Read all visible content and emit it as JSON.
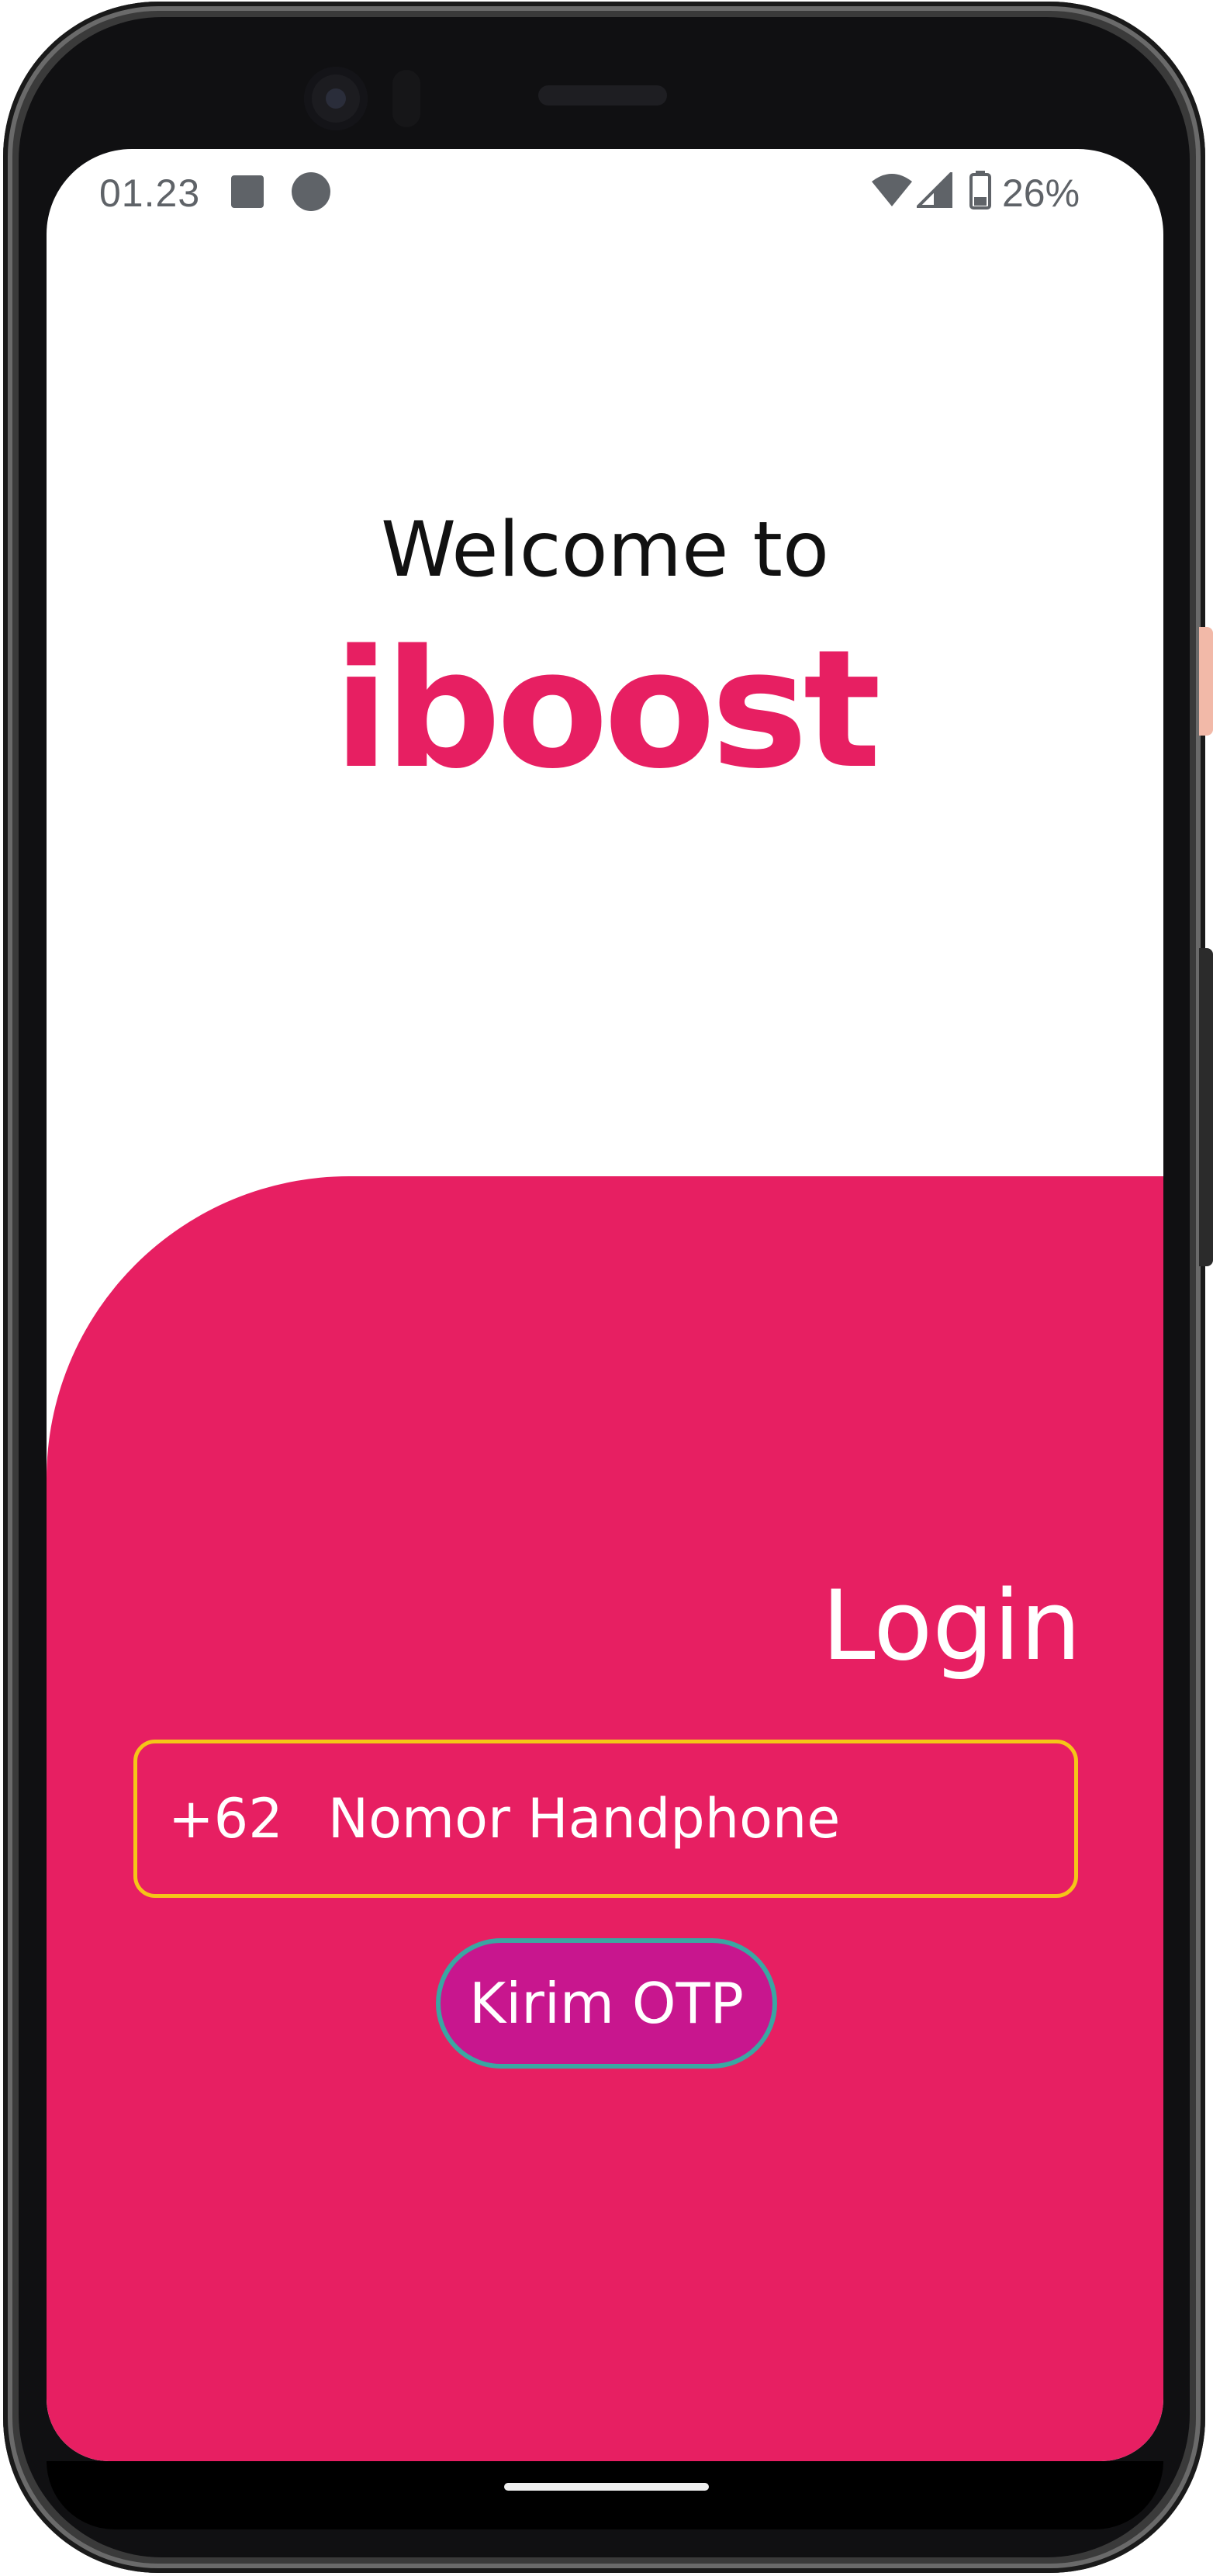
{
  "status_bar": {
    "time": "01.23",
    "battery_percent": "26%"
  },
  "welcome": {
    "line": "Welcome to",
    "brand": "iboost",
    "brand_color": "#e71f62"
  },
  "login": {
    "title": "Login",
    "country_code": "+62",
    "phone_placeholder": "Nomor Handphone",
    "phone_value": "",
    "otp_button_label": "Kirim OTP",
    "panel_color": "#e71f62",
    "field_border_color": "#f5c518",
    "button_fill_color": "#c8168e",
    "button_border_color": "#3aa6a2"
  }
}
